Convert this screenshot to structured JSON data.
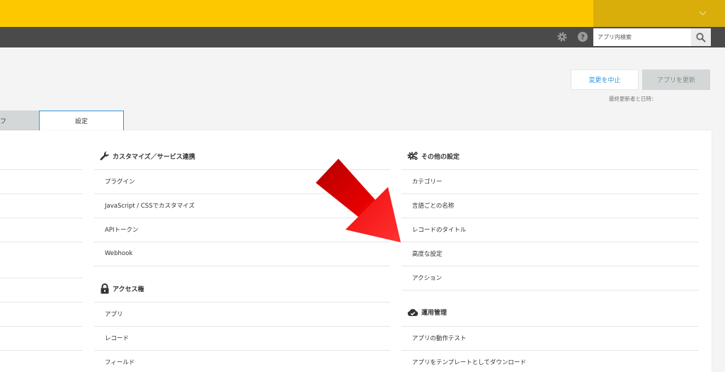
{
  "header": {
    "search_placeholder": "アプリ内検索"
  },
  "actions": {
    "cancel_label": "変更を中止",
    "update_label": "アプリを更新",
    "last_updated": "最終更新者と日時："
  },
  "tabs": [
    {
      "label": "フ"
    },
    {
      "label": "設定"
    }
  ],
  "sections": {
    "customize": {
      "title": "カスタマイズ／サービス連携",
      "icon": "wrench-icon",
      "items": [
        "プラグイン",
        "JavaScript / CSSでカスタマイズ",
        "APIトークン",
        "Webhook"
      ]
    },
    "access": {
      "title": "アクセス権",
      "icon": "lock-icon",
      "items": [
        "アプリ",
        "レコード",
        "フィールド"
      ]
    },
    "other": {
      "title": "その他の設定",
      "icon": "gears-icon",
      "items": [
        "カテゴリー",
        "言語ごとの名称",
        "レコードのタイトル",
        "高度な設定",
        "アクション"
      ]
    },
    "operation": {
      "title": "運用管理",
      "icon": "cloud-check-icon",
      "items": [
        "アプリの動作テスト",
        "アプリをテンプレートとしてダウンロード"
      ]
    }
  },
  "colors": {
    "topbar": "#fec800",
    "appbar": "#4a4a4a",
    "accent": "#3498db",
    "arrow": "#e00000"
  }
}
